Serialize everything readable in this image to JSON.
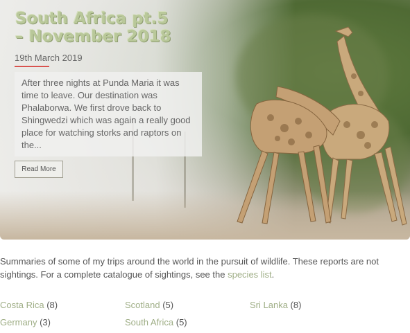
{
  "post": {
    "title": "South Africa pt.5 – November 2018",
    "date": "19th March 2019",
    "excerpt": "After three nights at Punda Maria it was time to leave. Our destination was Phalaborwa. We first drove back to Shingwedzi which was again a really good place for watching storks and raptors on the...",
    "read_more_label": "Read More"
  },
  "intro": {
    "text_before": "Summaries of some of my trips around the world in the pursuit of wildlife. These reports are not",
    "text_line2": "sightings. For a complete catalogue of sightings, see the ",
    "link_label": "species list",
    "text_after": "."
  },
  "categories": [
    {
      "name": "Costa Rica",
      "count": "(8)"
    },
    {
      "name": "Scotland",
      "count": "(5)"
    },
    {
      "name": "Sri Lanka",
      "count": "(8)"
    },
    {
      "name": "Germany",
      "count": "(3)"
    },
    {
      "name": "South Africa",
      "count": "(5)"
    }
  ],
  "colors": {
    "accent_link": "#9fae86",
    "date_underline": "#d9534f",
    "title_text": "#b9c89a"
  }
}
